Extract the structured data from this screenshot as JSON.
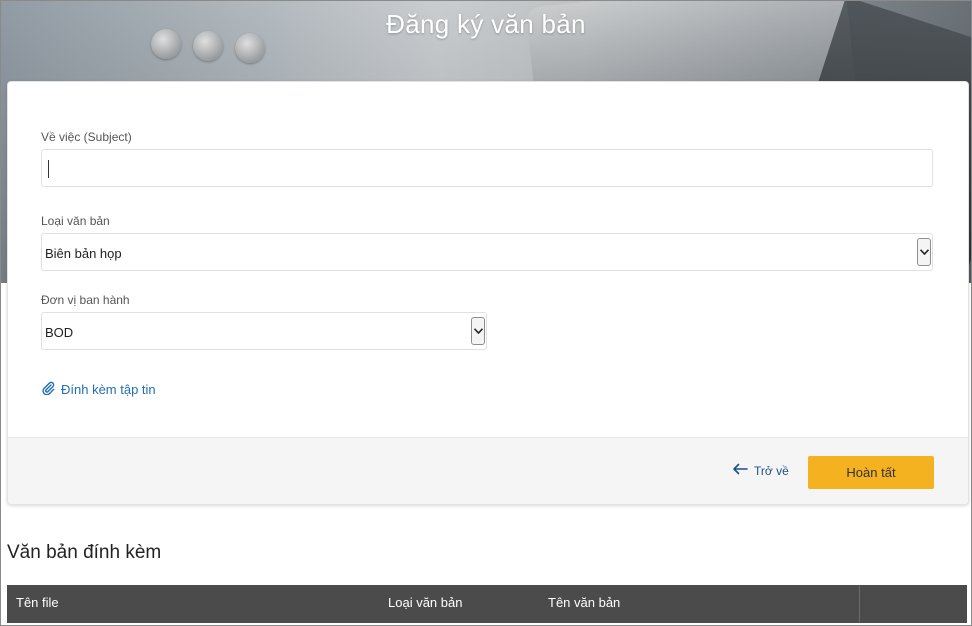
{
  "header": {
    "title": "Đăng ký văn bản"
  },
  "form": {
    "subject_label": "Về việc (Subject)",
    "subject_value": "",
    "doc_type_label": "Loại văn bản",
    "doc_type_value": "Biên bản họp",
    "issuer_label": "Đơn vị ban hành",
    "issuer_value": "BOD",
    "attach_label": "Đính kèm tập tin"
  },
  "actions": {
    "back_label": "Trở về",
    "done_label": "Hoàn tất"
  },
  "attachments": {
    "title": "Văn bản đính kèm",
    "columns": [
      "Tên file",
      "Loại văn bản",
      "Tên văn bản"
    ]
  },
  "colors": {
    "accent": "#f4b120",
    "link": "#1f6fb5",
    "table_header": "#4b4b4b"
  },
  "icons": {
    "attach": "paperclip-icon",
    "back": "arrow-left-icon",
    "select": "chevron-down-icon"
  }
}
